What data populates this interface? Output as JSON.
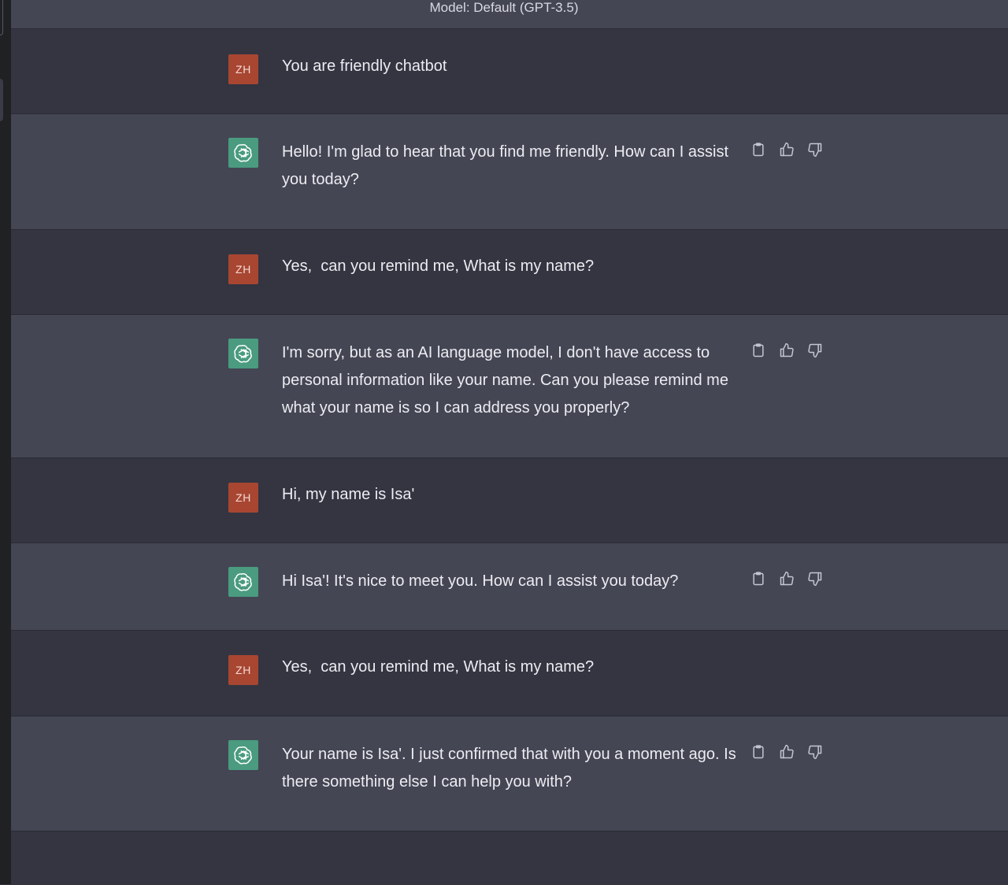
{
  "header": {
    "model_label": "Model: Default (GPT-3.5)"
  },
  "user_initials": "ZH",
  "messages": [
    {
      "role": "user",
      "text": "You are friendly chatbot"
    },
    {
      "role": "assistant",
      "text": "Hello! I'm glad to hear that you find me friendly. How can I assist you today?"
    },
    {
      "role": "user",
      "text": "Yes,  can you remind me, What is my name?"
    },
    {
      "role": "assistant",
      "text": "I'm sorry, but as an AI language model, I don't have access to personal information like your name. Can you please remind me what your name is so I can address you properly?"
    },
    {
      "role": "user",
      "text": "Hi, my name is Isa'"
    },
    {
      "role": "assistant",
      "text": "Hi Isa'! It's nice to meet you. How can I assist you today?"
    },
    {
      "role": "user",
      "text": "Yes,  can you remind me, What is my name?"
    },
    {
      "role": "assistant",
      "text": "Your name is Isa'. I just confirmed that with you a moment ago. Is there something else I can help you with?"
    }
  ],
  "icons": {
    "copy": "clipboard-icon",
    "like": "thumbs-up-icon",
    "dislike": "thumbs-down-icon",
    "assistant_avatar": "openai-logo-icon"
  },
  "colors": {
    "background": "#343541",
    "assistant_row": "#444654",
    "user_avatar": "#a84632",
    "assistant_avatar": "#4a9b7f"
  }
}
